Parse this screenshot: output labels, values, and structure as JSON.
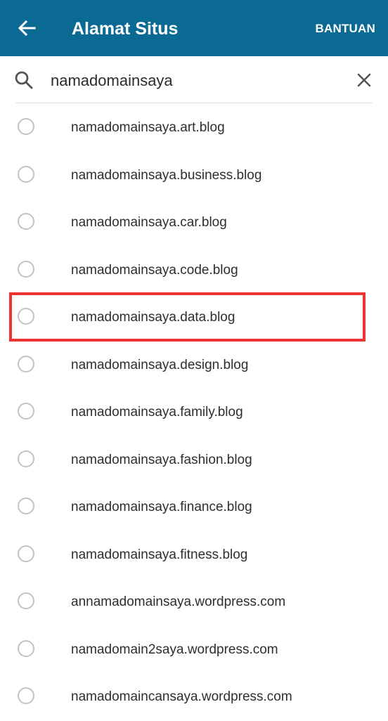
{
  "header": {
    "title": "Alamat Situs",
    "help_label": "BANTUAN",
    "background_color": "#0b6a93",
    "back_icon": "arrow-left-icon"
  },
  "search": {
    "value": "namadomainsaya",
    "search_icon": "search-icon",
    "clear_icon": "close-icon"
  },
  "domains": [
    {
      "label": "namadomainsaya.art.blog"
    },
    {
      "label": "namadomainsaya.business.blog"
    },
    {
      "label": "namadomainsaya.car.blog"
    },
    {
      "label": "namadomainsaya.code.blog"
    },
    {
      "label": "namadomainsaya.data.blog",
      "highlighted": true
    },
    {
      "label": "namadomainsaya.design.blog"
    },
    {
      "label": "namadomainsaya.family.blog"
    },
    {
      "label": "namadomainsaya.fashion.blog"
    },
    {
      "label": "namadomainsaya.finance.blog"
    },
    {
      "label": "namadomainsaya.fitness.blog"
    },
    {
      "label": "annamadomainsaya.wordpress.com"
    },
    {
      "label": "namadomain2saya.wordpress.com"
    },
    {
      "label": "namadomaincansaya.wordpress.com"
    }
  ],
  "highlight_color": "#ee3333"
}
